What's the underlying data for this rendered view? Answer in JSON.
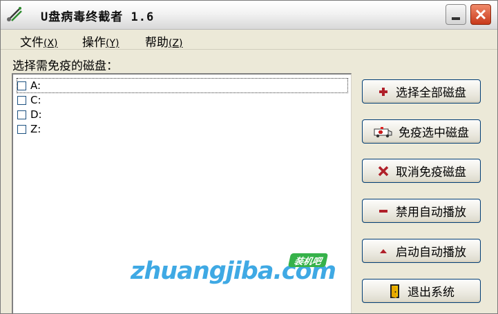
{
  "window": {
    "title": "U盘病毒终截者 1.6"
  },
  "menu": [
    {
      "label": "文件",
      "accel": "(X)"
    },
    {
      "label": "操作",
      "accel": "(Y)"
    },
    {
      "label": "帮助",
      "accel": "(Z)"
    }
  ],
  "drives": {
    "label": "选择需免疫的磁盘：",
    "items": [
      {
        "name": "A:",
        "checked": false
      },
      {
        "name": "C:",
        "checked": false
      },
      {
        "name": "D:",
        "checked": false
      },
      {
        "name": "Z:",
        "checked": false
      }
    ]
  },
  "buttons": {
    "select_all": {
      "label": "选择全部磁盘",
      "icon": "plus-icon"
    },
    "immunize": {
      "label": "免疫选中磁盘",
      "icon": "ambulance-icon"
    },
    "cancel_immunize": {
      "label": "取消免疫磁盘",
      "icon": "x-icon"
    },
    "disable_autoplay": {
      "label": "禁用自动播放",
      "icon": "minus-icon"
    },
    "enable_autoplay": {
      "label": "启动自动播放",
      "icon": "triangle-up-icon"
    },
    "exit": {
      "label": "退出系统",
      "icon": "exit-door-icon"
    }
  },
  "watermark": {
    "text": "zhuangjiba.com",
    "badge": "装机吧"
  },
  "colors": {
    "face": "#ece9d8",
    "button_border": "#003c74",
    "icon_red": "#b0202a",
    "watermark": "#1e9be0",
    "badge": "#36b24a"
  }
}
